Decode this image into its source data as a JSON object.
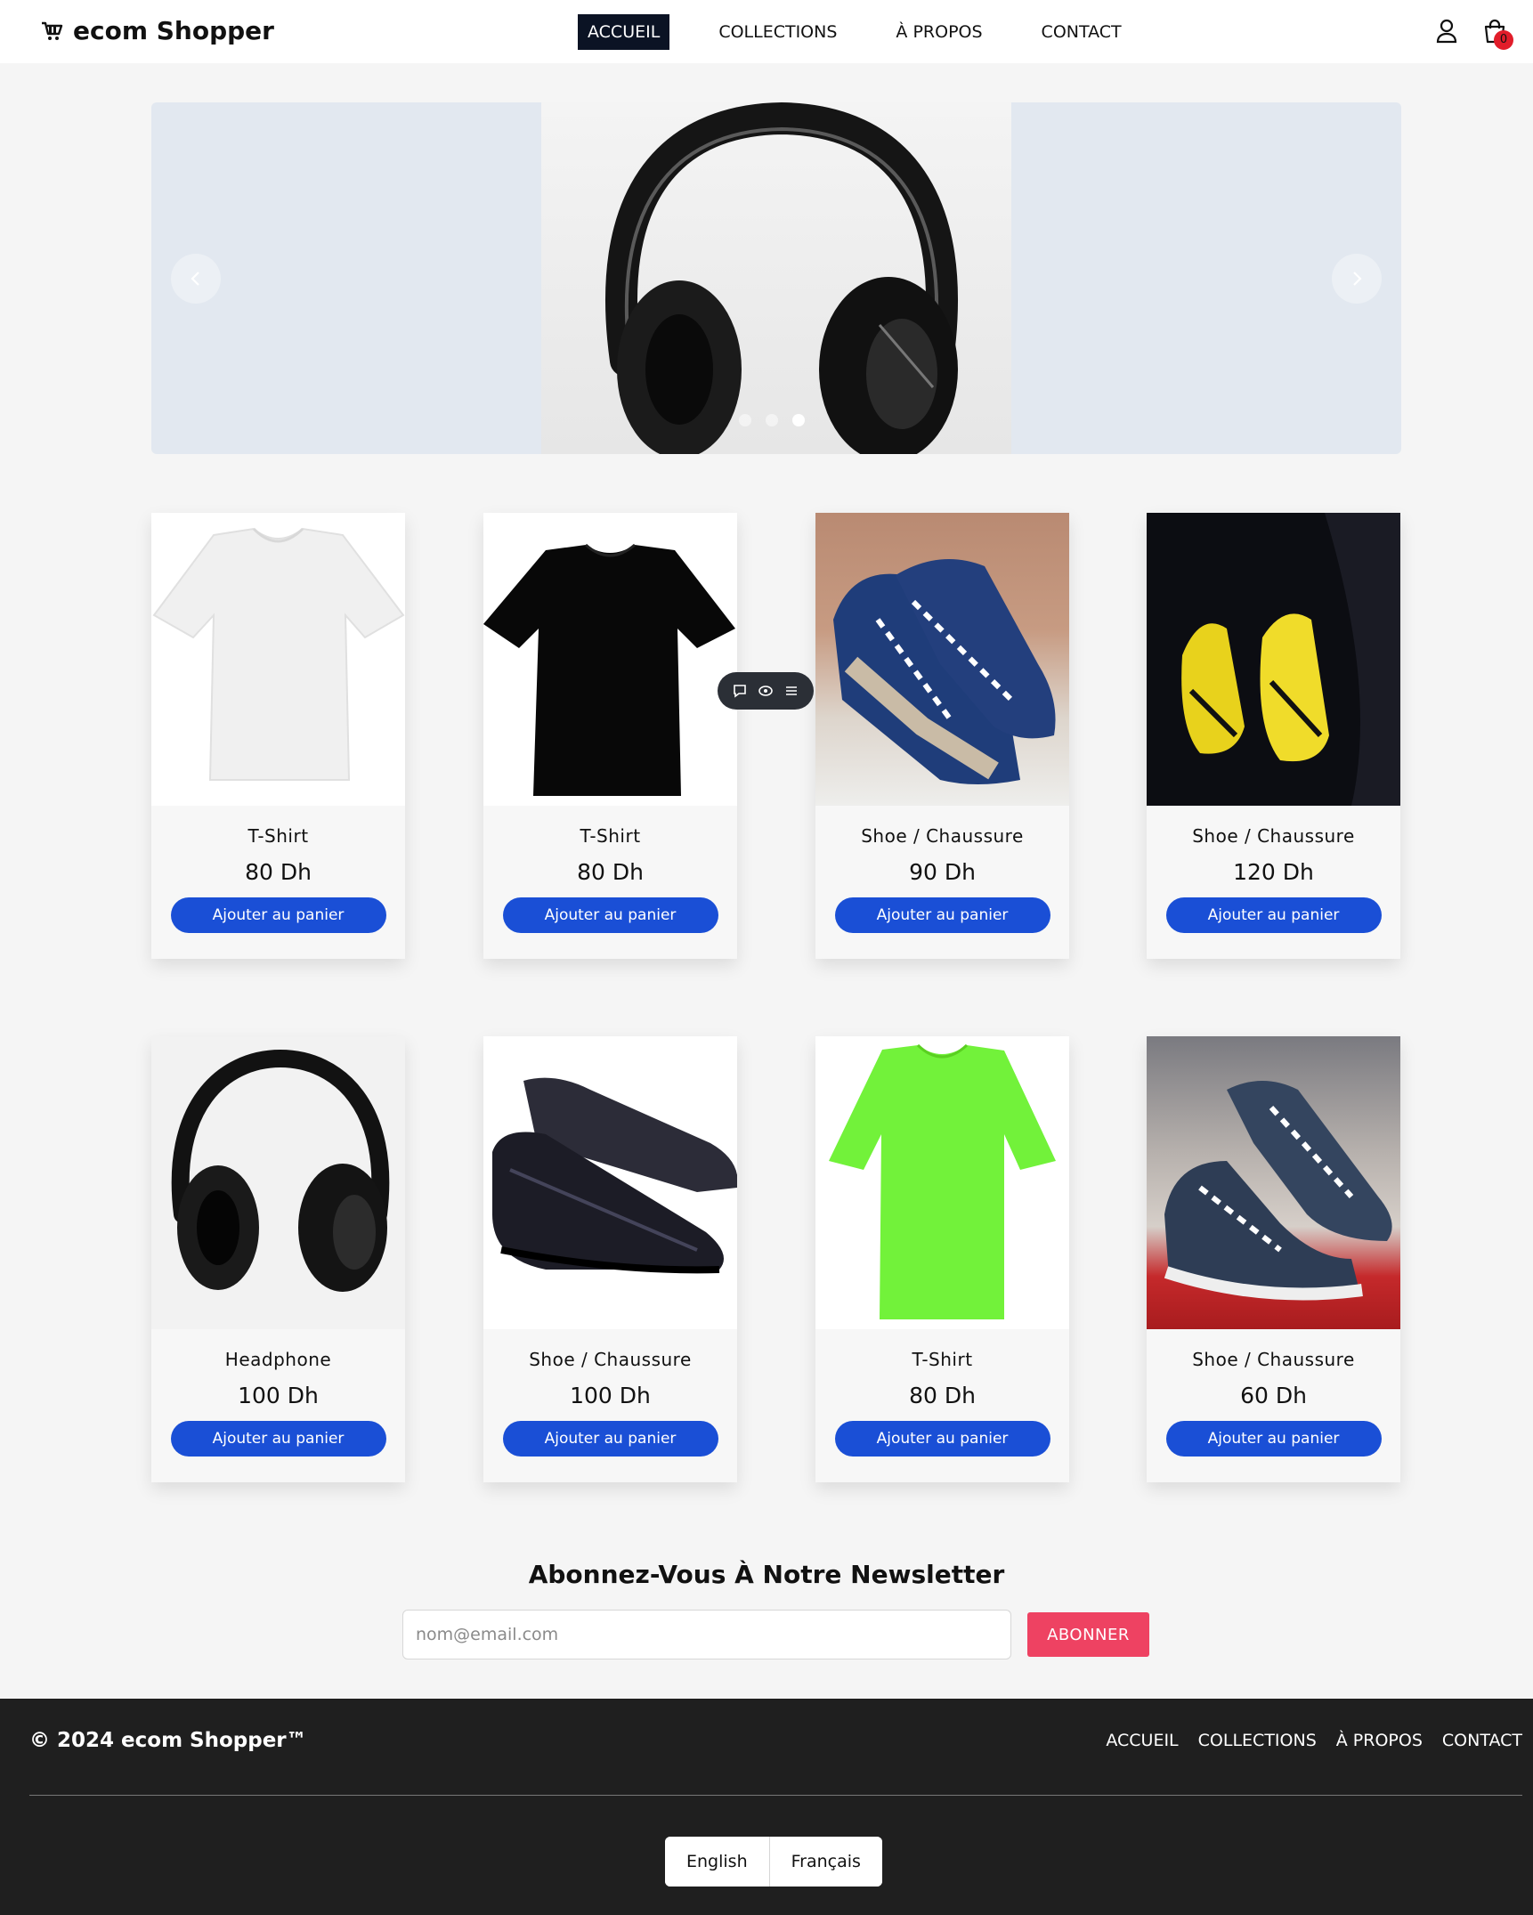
{
  "header": {
    "logo_text": "ecom Shopper",
    "nav": [
      "ACCUEIL",
      "COLLECTIONS",
      "À PROPOS",
      "CONTACT"
    ],
    "active_nav": "ACCUEIL",
    "cart_count": "0",
    "icons": [
      "shopping-cart-icon",
      "user-icon",
      "shopping-bag-icon"
    ]
  },
  "carousel": {
    "slides": 3,
    "active_slide": 3,
    "image": "headphones-photo"
  },
  "products": [
    {
      "name": "T-Shirt",
      "price": "80 Dh",
      "button": "Ajouter au panier",
      "image": "white-tshirt"
    },
    {
      "name": "T-Shirt",
      "price": "80 Dh",
      "button": "Ajouter au panier",
      "image": "black-tshirt"
    },
    {
      "name": "Shoe / Chaussure",
      "price": "90 Dh",
      "button": "Ajouter au panier",
      "image": "blue-sneakers"
    },
    {
      "name": "Shoe / Chaussure",
      "price": "120 Dh",
      "button": "Ajouter au panier",
      "image": "yellow-sneakers"
    },
    {
      "name": "Headphone",
      "price": "100 Dh",
      "button": "Ajouter au panier",
      "image": "black-headphones"
    },
    {
      "name": "Shoe / Chaussure",
      "price": "100 Dh",
      "button": "Ajouter au panier",
      "image": "leather-shoes"
    },
    {
      "name": "T-Shirt",
      "price": "80 Dh",
      "button": "Ajouter au panier",
      "image": "green-tshirt"
    },
    {
      "name": "Shoe / Chaussure",
      "price": "60 Dh",
      "button": "Ajouter au panier",
      "image": "navy-canvas-sneakers"
    }
  ],
  "newsletter": {
    "title": "Abonnez-Vous À Notre Newsletter",
    "placeholder": "nom@email.com",
    "button": "ABONNER"
  },
  "footer": {
    "copyright": "© 2024 ecom Shopper™",
    "nav": [
      "ACCUEIL",
      "COLLECTIONS",
      "À PROPOS",
      "CONTACT"
    ],
    "languages": [
      "English",
      "Français"
    ]
  },
  "colors": {
    "accent_button": "#1a4fd6",
    "nav_active": "#0b1324",
    "subscribe": "#ee4262",
    "footer_bg": "#1f1f1f",
    "badge": "#e11d2a"
  }
}
